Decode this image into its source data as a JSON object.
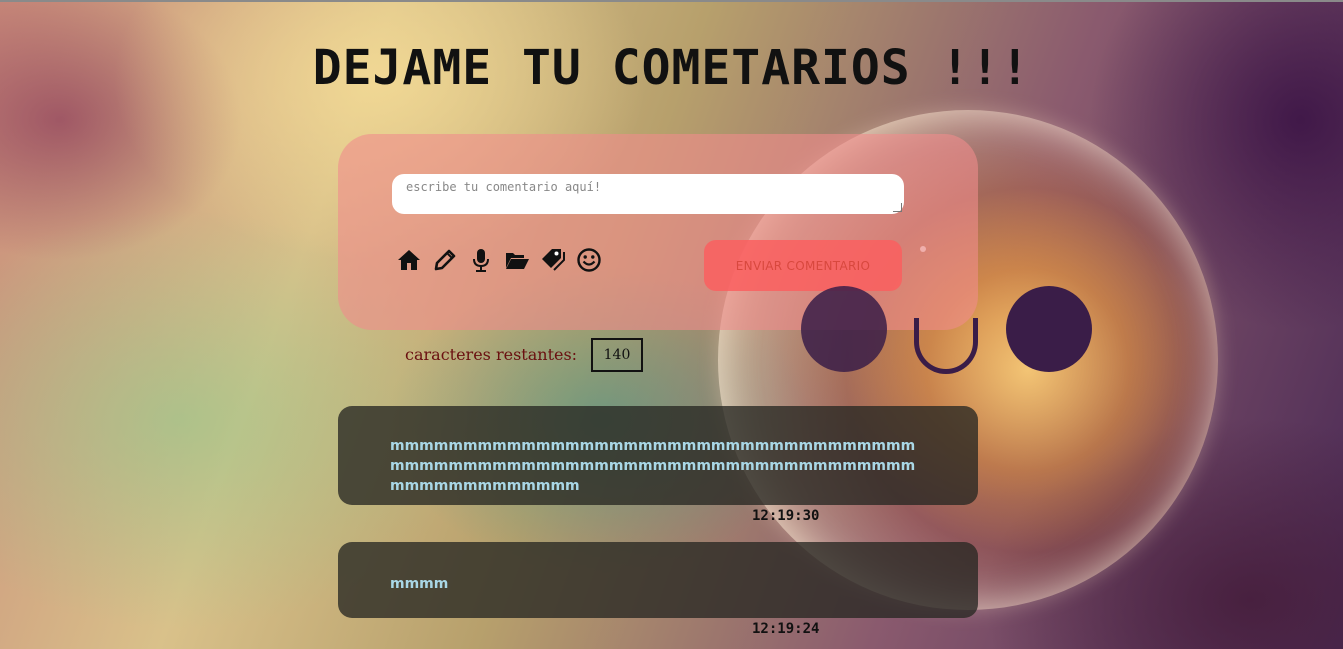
{
  "page": {
    "title": "DEJAME TU COMETARIOS !!!"
  },
  "form": {
    "placeholder": "escribe tu comentario aquí!",
    "value": "",
    "submit_label": "ENVIAR COMENTARIO",
    "icons": [
      "home-icon",
      "pencil-icon",
      "microphone-icon",
      "folder-open-icon",
      "tags-icon",
      "smile-icon"
    ]
  },
  "counter": {
    "label": "caracteres restantes:",
    "value": "140"
  },
  "comments": [
    {
      "text": "mmmmmmmmmmmmmmmmmmmmmmmmmmmmmmmmmmmmmmmmmmmmmmmmmmmmmmmmmmmmmmmmmmmmmmmmmmmmmmmmmmmmm",
      "time": "12:19:30"
    },
    {
      "text": "mmmm",
      "time": "12:19:24"
    }
  ],
  "colors": {
    "form_panel": "#f08c8c",
    "submit_button": "#fa5f5f",
    "comment_card": "#282822",
    "comment_text": "#a9d7e6",
    "face": "#3a1d48",
    "counter_label": "#6a1010"
  }
}
